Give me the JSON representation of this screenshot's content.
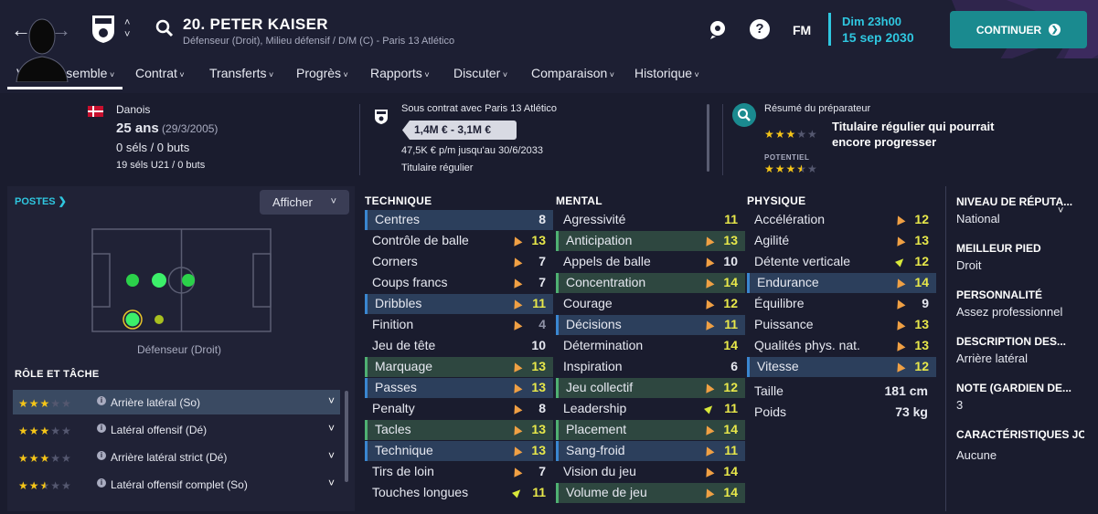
{
  "header": {
    "player_name": "20. PETER KAISER",
    "player_sub": "Défenseur (Droit), Milieu défensif / D/M (C) - Paris 13 Atlético",
    "fm_logo": "FM",
    "help": "?",
    "date_line1": "Dim 23h00",
    "date_line2": "15 sep 2030",
    "continue_label": "CONTINUER",
    "accent": "#2fc7e0",
    "button_color": "#1a8a8f"
  },
  "tabs": [
    "Vue d'ensemble",
    "Contrat",
    "Transferts",
    "Progrès",
    "Rapports",
    "Discuter",
    "Comparaison",
    "Historique"
  ],
  "summary": {
    "nationality": "Danois",
    "age": "25 ans",
    "dob": "(29/3/2005)",
    "caps": "0 séls / 0 buts",
    "u21_caps": "19 séls U21 / 0 buts",
    "contract_title": "Sous contrat avec Paris 13 Atlético",
    "value": "1,4M € - 3,1M €",
    "wage": "47,5K € p/m jusqu'au 30/6/2033",
    "status": "Titulaire régulier",
    "scout_title": "Résumé du préparateur",
    "scout_text": "Titulaire régulier qui pourrait encore progresser",
    "potential_label": "POTENTIEL",
    "current_stars": 3,
    "potential_stars": 3.5
  },
  "positions": {
    "title": "POSTES",
    "show_button": "Afficher",
    "label": "Défenseur (Droit)"
  },
  "roles": {
    "title": "RÔLE ET TÂCHE",
    "items": [
      {
        "name": "Arrière latéral (So)",
        "stars": 3,
        "selected": true
      },
      {
        "name": "Latéral offensif (Dé)",
        "stars": 3,
        "selected": false
      },
      {
        "name": "Arrière latéral strict (Dé)",
        "stars": 3,
        "selected": false
      },
      {
        "name": "Latéral offensif complet (So)",
        "stars": 2.5,
        "selected": false
      }
    ]
  },
  "technique": {
    "title": "TECHNIQUE",
    "items": [
      {
        "name": "Centres",
        "value": "8",
        "hl": "blue",
        "arrow": "none",
        "tone": "mid"
      },
      {
        "name": "Contrôle de balle",
        "value": "13",
        "hl": "none",
        "arrow": "up",
        "tone": "hi"
      },
      {
        "name": "Corners",
        "value": "7",
        "hl": "none",
        "arrow": "up",
        "tone": "mid"
      },
      {
        "name": "Coups francs",
        "value": "7",
        "hl": "none",
        "arrow": "up",
        "tone": "mid"
      },
      {
        "name": "Dribbles",
        "value": "11",
        "hl": "blue",
        "arrow": "up",
        "tone": "hi"
      },
      {
        "name": "Finition",
        "value": "4",
        "hl": "none",
        "arrow": "up",
        "tone": "lo"
      },
      {
        "name": "Jeu de tête",
        "value": "10",
        "hl": "none",
        "arrow": "none",
        "tone": "mid"
      },
      {
        "name": "Marquage",
        "value": "13",
        "hl": "green",
        "arrow": "up",
        "tone": "hi"
      },
      {
        "name": "Passes",
        "value": "13",
        "hl": "blue",
        "arrow": "up",
        "tone": "hi"
      },
      {
        "name": "Penalty",
        "value": "8",
        "hl": "none",
        "arrow": "up",
        "tone": "mid"
      },
      {
        "name": "Tacles",
        "value": "13",
        "hl": "green",
        "arrow": "up",
        "tone": "hi"
      },
      {
        "name": "Technique",
        "value": "13",
        "hl": "blue",
        "arrow": "up",
        "tone": "hi"
      },
      {
        "name": "Tirs de loin",
        "value": "7",
        "hl": "none",
        "arrow": "up",
        "tone": "mid"
      },
      {
        "name": "Touches longues",
        "value": "11",
        "hl": "none",
        "arrow": "tilt",
        "tone": "hi"
      }
    ]
  },
  "mental": {
    "title": "MENTAL",
    "items": [
      {
        "name": "Agressivité",
        "value": "11",
        "hl": "none",
        "arrow": "none",
        "tone": "hi"
      },
      {
        "name": "Anticipation",
        "value": "13",
        "hl": "green",
        "arrow": "up",
        "tone": "hi"
      },
      {
        "name": "Appels de balle",
        "value": "10",
        "hl": "none",
        "arrow": "up",
        "tone": "mid"
      },
      {
        "name": "Concentration",
        "value": "14",
        "hl": "green",
        "arrow": "up",
        "tone": "hi"
      },
      {
        "name": "Courage",
        "value": "12",
        "hl": "none",
        "arrow": "up",
        "tone": "hi"
      },
      {
        "name": "Décisions",
        "value": "11",
        "hl": "blue",
        "arrow": "up",
        "tone": "hi"
      },
      {
        "name": "Détermination",
        "value": "14",
        "hl": "none",
        "arrow": "none",
        "tone": "hi"
      },
      {
        "name": "Inspiration",
        "value": "6",
        "hl": "none",
        "arrow": "none",
        "tone": "mid"
      },
      {
        "name": "Jeu collectif",
        "value": "12",
        "hl": "green",
        "arrow": "up",
        "tone": "hi"
      },
      {
        "name": "Leadership",
        "value": "11",
        "hl": "none",
        "arrow": "tilt",
        "tone": "hi"
      },
      {
        "name": "Placement",
        "value": "14",
        "hl": "green",
        "arrow": "up",
        "tone": "hi"
      },
      {
        "name": "Sang-froid",
        "value": "11",
        "hl": "blue",
        "arrow": "up",
        "tone": "hi"
      },
      {
        "name": "Vision du jeu",
        "value": "14",
        "hl": "none",
        "arrow": "up",
        "tone": "hi"
      },
      {
        "name": "Volume de jeu",
        "value": "14",
        "hl": "green",
        "arrow": "up",
        "tone": "hi"
      }
    ]
  },
  "physique": {
    "title": "PHYSIQUE",
    "items": [
      {
        "name": "Accélération",
        "value": "12",
        "hl": "none",
        "arrow": "up",
        "tone": "hi"
      },
      {
        "name": "Agilité",
        "value": "13",
        "hl": "none",
        "arrow": "up",
        "tone": "hi"
      },
      {
        "name": "Détente verticale",
        "value": "12",
        "hl": "none",
        "arrow": "tilt",
        "tone": "hi"
      },
      {
        "name": "Endurance",
        "value": "14",
        "hl": "blue",
        "arrow": "up",
        "tone": "hi"
      },
      {
        "name": "Équilibre",
        "value": "9",
        "hl": "none",
        "arrow": "up",
        "tone": "mid"
      },
      {
        "name": "Puissance",
        "value": "13",
        "hl": "none",
        "arrow": "up",
        "tone": "hi"
      },
      {
        "name": "Qualités phys. nat.",
        "value": "13",
        "hl": "none",
        "arrow": "up",
        "tone": "hi"
      },
      {
        "name": "Vitesse",
        "value": "12",
        "hl": "blue",
        "arrow": "up",
        "tone": "hi"
      }
    ],
    "height_label": "Taille",
    "height_value": "181 cm",
    "weight_label": "Poids",
    "weight_value": "73 kg"
  },
  "info": [
    {
      "label": "NIVEAU DE RÉPUTA...",
      "value": "National"
    },
    {
      "label": "MEILLEUR PIED",
      "value": "Droit"
    },
    {
      "label": "PERSONNALITÉ",
      "value": "Assez professionnel"
    },
    {
      "label": "DESCRIPTION DES...",
      "value": "Arrière latéral"
    },
    {
      "label": "NOTE (GARDIEN DE...",
      "value": "3"
    },
    {
      "label": "CARACTÉRISTIQUES JO",
      "value": "Aucune"
    }
  ]
}
